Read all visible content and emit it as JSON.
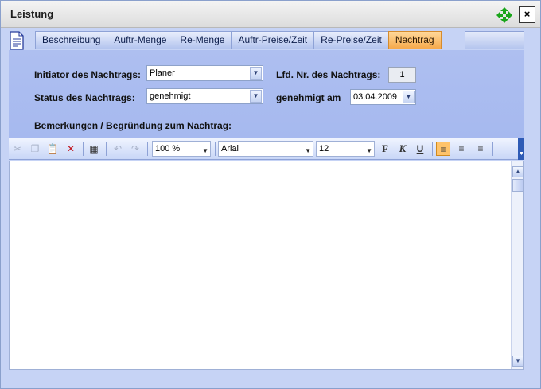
{
  "window": {
    "title": "Leistung",
    "close_label": "×"
  },
  "tabs": [
    {
      "label": "Beschreibung",
      "active": false
    },
    {
      "label": "Auftr-Menge",
      "active": false
    },
    {
      "label": "Re-Menge",
      "active": false
    },
    {
      "label": "Auftr-Preise/Zeit",
      "active": false
    },
    {
      "label": "Re-Preise/Zeit",
      "active": false
    },
    {
      "label": "Nachtrag",
      "active": true
    }
  ],
  "form": {
    "initiator_label": "Initiator des Nachtrags:",
    "initiator_value": "Planer",
    "lfd_label": "Lfd. Nr. des Nachtrags:",
    "lfd_value": "1",
    "status_label": "Status des Nachtrags:",
    "status_value": "genehmigt",
    "approved_label": "genehmigt am",
    "approved_value": "03.04.2009",
    "remarks_label": "Bemerkungen / Begründung zum Nachtrag:"
  },
  "toolbar": {
    "zoom": "100 %",
    "font": "Arial",
    "size": "12",
    "bold_label": "F",
    "italic_label": "K",
    "underline_label": "U"
  },
  "colors": {
    "active_tab": "#f6a94b",
    "panel": "#aebff0",
    "accent": "#2e5bb6"
  }
}
